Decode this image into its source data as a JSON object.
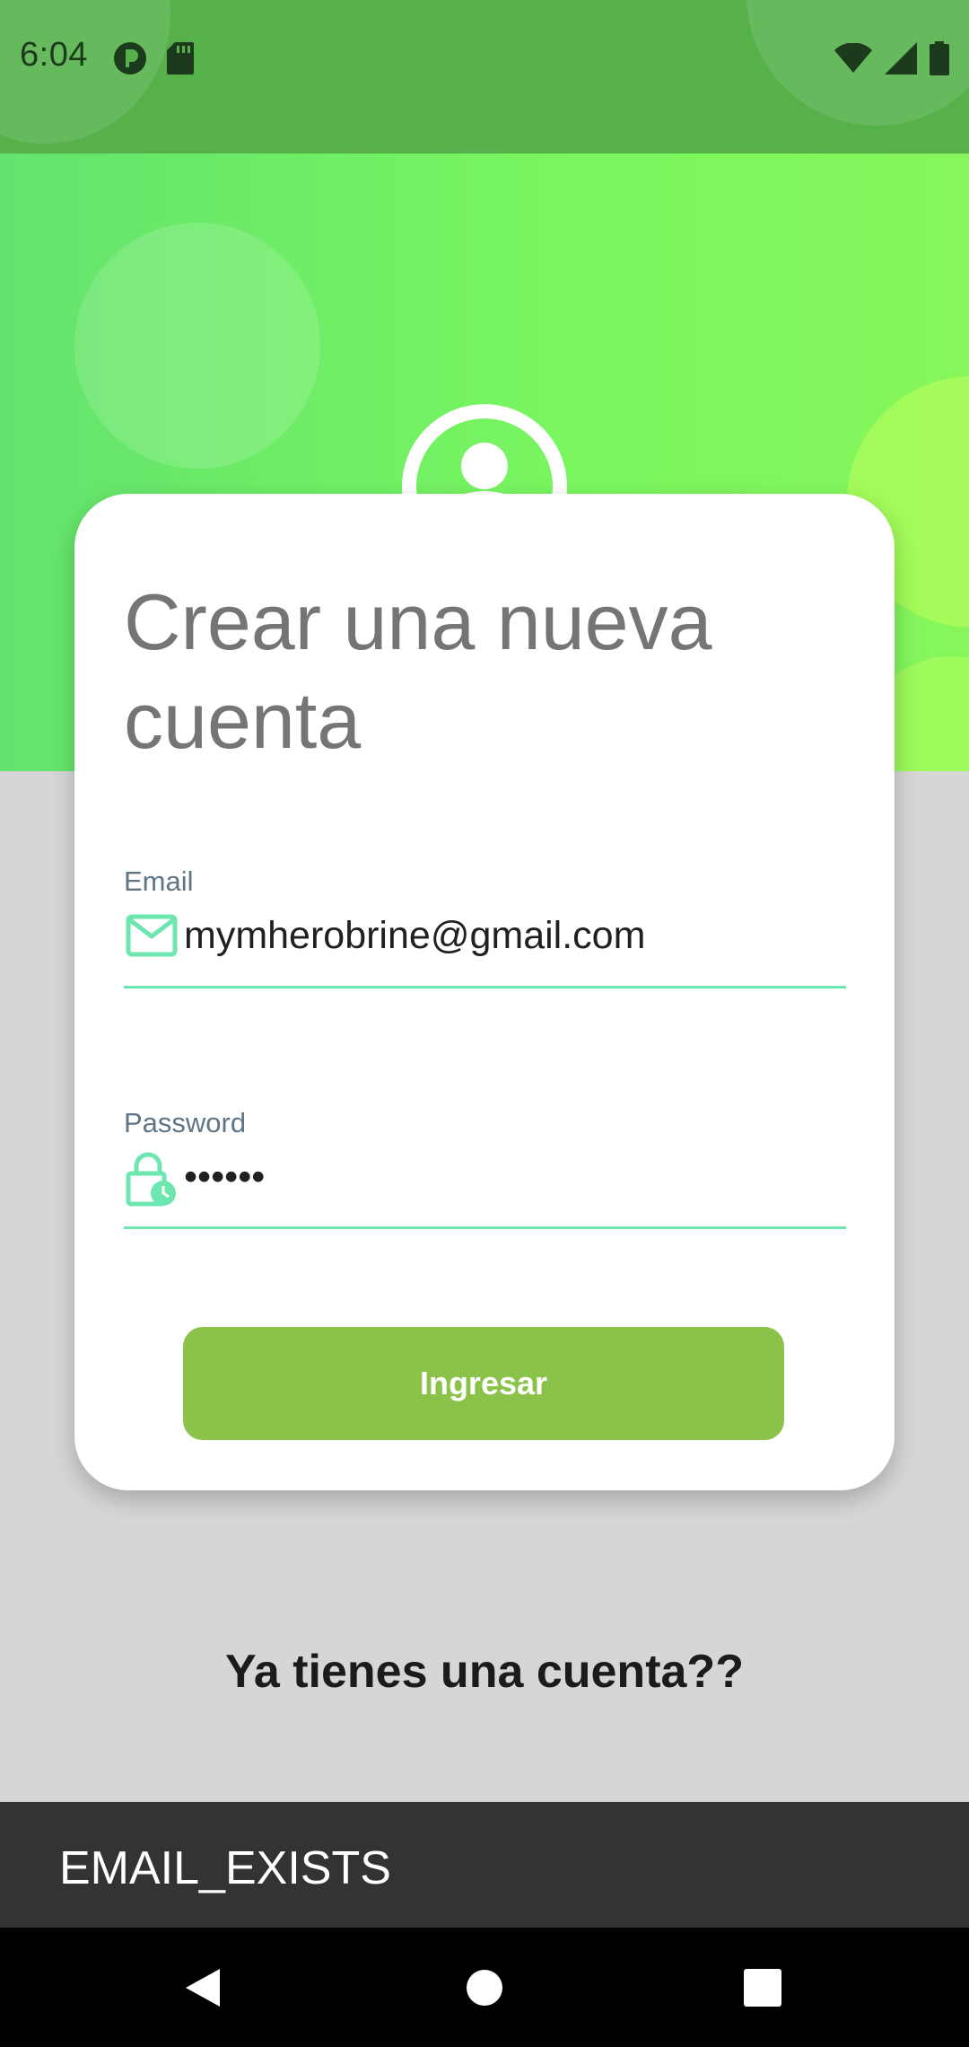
{
  "status_bar": {
    "time": "6:04",
    "left_icons": [
      "record-icon",
      "sd-card-icon"
    ],
    "right_icons": [
      "wifi-icon",
      "cellular-signal-icon",
      "battery-icon"
    ]
  },
  "header": {
    "logo_icon": "location-pin-user-icon"
  },
  "form": {
    "title": "Crear una nueva cuenta",
    "email": {
      "label": "Email",
      "value": "mymherobrine@gmail.com",
      "icon": "mail-icon"
    },
    "password": {
      "label": "Password",
      "value": "••••••",
      "icon": "lock-clock-icon"
    },
    "submit_label": "Ingresar"
  },
  "login_prompt": "Ya tienes una cuenta??",
  "snackbar": {
    "message": "EMAIL_EXISTS"
  },
  "nav": {
    "back": "back-icon",
    "home": "home-icon",
    "recents": "recents-icon"
  },
  "colors": {
    "status_bar": "#56b14b",
    "header_start": "#63e36e",
    "header_end": "#86f65b",
    "accent_line": "#6ee6b0",
    "button": "#8bc34a",
    "snackbar": "#333333"
  }
}
